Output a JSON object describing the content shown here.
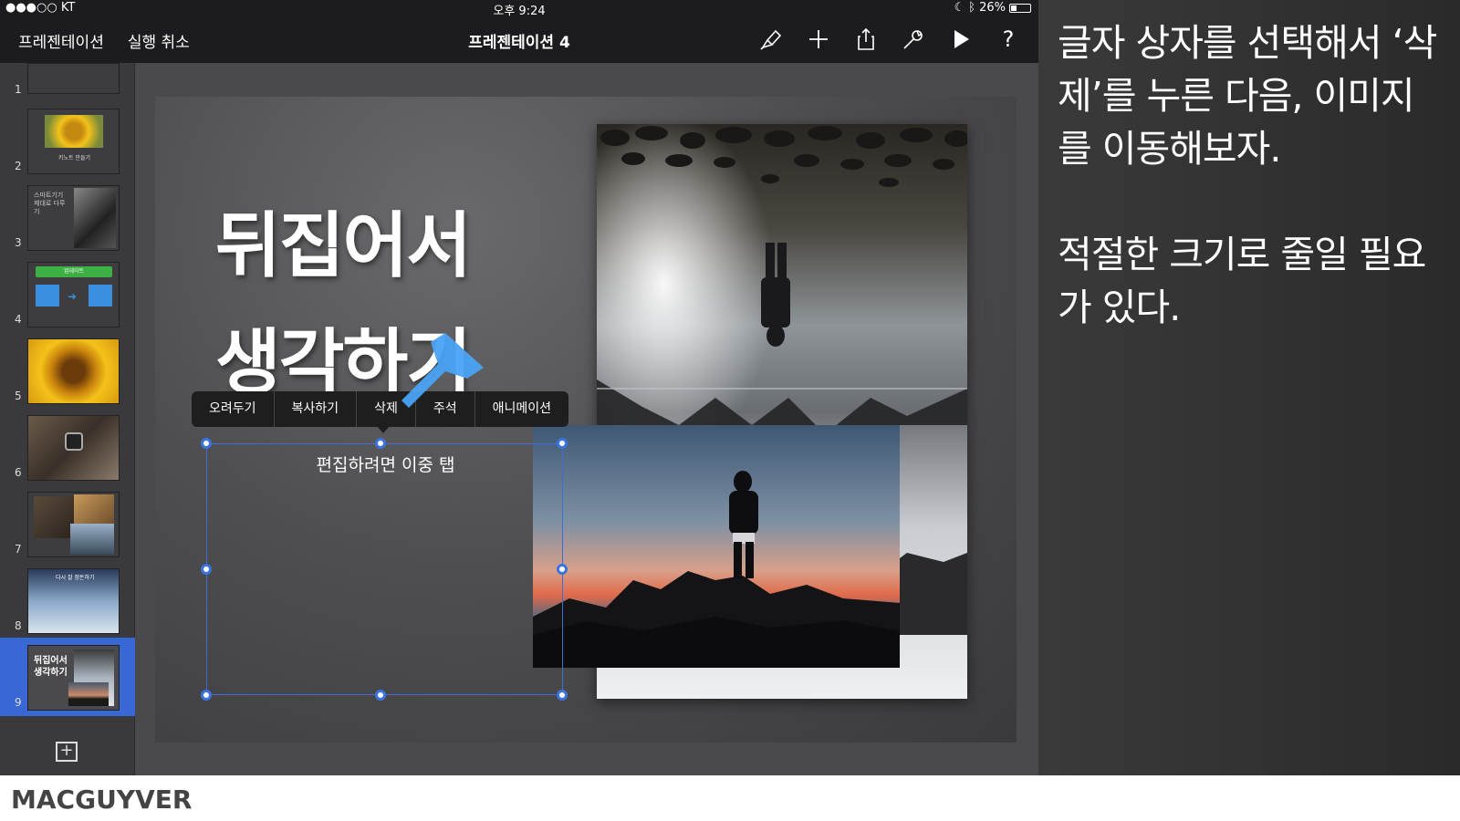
{
  "status_bar": {
    "carrier": "●●●○○ KT",
    "time": "오후 9:24",
    "battery": "26%"
  },
  "toolbar": {
    "back_label": "프레젠테이션",
    "undo_label": "실행 취소",
    "title": "프레젠테이션 4",
    "icons": [
      "format-brush-icon",
      "add-icon",
      "share-icon",
      "tools-wrench-icon",
      "play-icon",
      "help-icon"
    ],
    "help_glyph": "?"
  },
  "navigator": {
    "slides": [
      {
        "number": "1"
      },
      {
        "number": "2",
        "caption": "키노트 만들기"
      },
      {
        "number": "3",
        "caption": "스마트기기 제대로 다루기"
      },
      {
        "number": "4",
        "caption": "업데이트"
      },
      {
        "number": "5"
      },
      {
        "number": "6"
      },
      {
        "number": "7"
      },
      {
        "number": "8",
        "caption": "다시 잘 정돈하기"
      },
      {
        "number": "9",
        "caption": "뒤집어서 생각하기",
        "selected": true
      }
    ],
    "add_glyph": "+"
  },
  "slide": {
    "title_line1": "뒤집어서",
    "title_line2": "생각하기",
    "textbox_placeholder": "편집하려면 이중 탭"
  },
  "context_menu": {
    "items": [
      "오려두기",
      "복사하기",
      "삭제",
      "주석",
      "애니메이션"
    ]
  },
  "caption": {
    "paragraph1": "글자 상자를 선택해서 ‘삭제’를 누른 다음, 이미지를 이동해보자.",
    "paragraph2": "적절한 크기로 줄일 필요가 있다."
  },
  "footer": {
    "brand": "MACGUYVER"
  },
  "colors": {
    "selection_blue": "#3b73e0",
    "arrow_blue": "#4aa3f5",
    "toolbar_bg": "#1c1c1e"
  }
}
